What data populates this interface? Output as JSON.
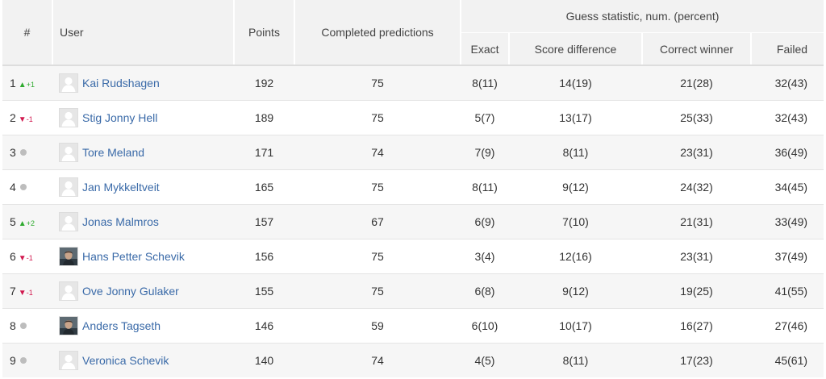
{
  "headers": {
    "rank": "#",
    "user": "User",
    "points": "Points",
    "completed": "Completed predictions",
    "group": "Guess statistic, num. (percent)",
    "exact": "Exact",
    "score_difference": "Score difference",
    "correct_winner": "Correct winner",
    "failed": "Failed"
  },
  "colors": {
    "link": "#3a6aa8",
    "up": "#2eaa2e",
    "down": "#d1184e",
    "neutral": "#bdbdbd"
  },
  "rows": [
    {
      "rank": "1",
      "trend": "up",
      "trend_label": "+1",
      "user": "Kai Rudshagen",
      "avatar": "placeholder",
      "points": "192",
      "completed": "75",
      "exact": "8(11)",
      "score_difference": "14(19)",
      "correct_winner": "21(28)",
      "failed": "32(43)"
    },
    {
      "rank": "2",
      "trend": "down",
      "trend_label": "-1",
      "user": "Stig Jonny Hell",
      "avatar": "placeholder",
      "points": "189",
      "completed": "75",
      "exact": "5(7)",
      "score_difference": "13(17)",
      "correct_winner": "25(33)",
      "failed": "32(43)"
    },
    {
      "rank": "3",
      "trend": "same",
      "trend_label": "",
      "user": "Tore Meland",
      "avatar": "placeholder",
      "points": "171",
      "completed": "74",
      "exact": "7(9)",
      "score_difference": "8(11)",
      "correct_winner": "23(31)",
      "failed": "36(49)"
    },
    {
      "rank": "4",
      "trend": "same",
      "trend_label": "",
      "user": "Jan Mykkeltveit",
      "avatar": "placeholder",
      "points": "165",
      "completed": "75",
      "exact": "8(11)",
      "score_difference": "9(12)",
      "correct_winner": "24(32)",
      "failed": "34(45)"
    },
    {
      "rank": "5",
      "trend": "up",
      "trend_label": "+2",
      "user": "Jonas Malmros",
      "avatar": "placeholder",
      "points": "157",
      "completed": "67",
      "exact": "6(9)",
      "score_difference": "7(10)",
      "correct_winner": "21(31)",
      "failed": "33(49)"
    },
    {
      "rank": "6",
      "trend": "down",
      "trend_label": "-1",
      "user": "Hans Petter Schevik",
      "avatar": "photo",
      "points": "156",
      "completed": "75",
      "exact": "3(4)",
      "score_difference": "12(16)",
      "correct_winner": "23(31)",
      "failed": "37(49)"
    },
    {
      "rank": "7",
      "trend": "down",
      "trend_label": "-1",
      "user": "Ove Jonny Gulaker",
      "avatar": "placeholder",
      "points": "155",
      "completed": "75",
      "exact": "6(8)",
      "score_difference": "9(12)",
      "correct_winner": "19(25)",
      "failed": "41(55)"
    },
    {
      "rank": "8",
      "trend": "same",
      "trend_label": "",
      "user": "Anders Tagseth",
      "avatar": "photo",
      "points": "146",
      "completed": "59",
      "exact": "6(10)",
      "score_difference": "10(17)",
      "correct_winner": "16(27)",
      "failed": "27(46)"
    },
    {
      "rank": "9",
      "trend": "same",
      "trend_label": "",
      "user": "Veronica Schevik",
      "avatar": "placeholder",
      "points": "140",
      "completed": "74",
      "exact": "4(5)",
      "score_difference": "8(11)",
      "correct_winner": "17(23)",
      "failed": "45(61)"
    }
  ]
}
